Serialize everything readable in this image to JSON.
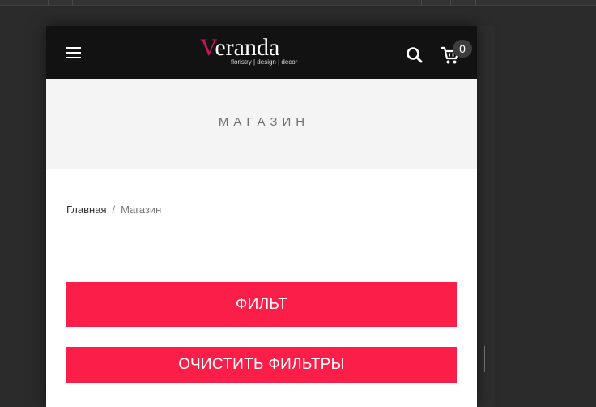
{
  "header": {
    "logo_text": "eranda",
    "logo_initial": "V",
    "logo_tagline": "floristry | design | decor",
    "cart_count": "0"
  },
  "banner": {
    "title": "МАГАЗИН"
  },
  "breadcrumb": {
    "home": "Главная",
    "separator": "/",
    "current": "Магазин"
  },
  "actions": {
    "filter_label": "ФИЛЬТ",
    "clear_label": "ОЧИСТИТЬ ФИЛЬТРЫ"
  },
  "icons": {
    "menu": "hamburger-menu-icon",
    "search": "search-icon",
    "cart": "cart-icon"
  },
  "colors": {
    "header_bg": "#121212",
    "accent": "#fb1e49",
    "logo_accent": "#c2185b",
    "banner_bg": "#f4f4f4",
    "page_bg": "#2b2b2b"
  }
}
